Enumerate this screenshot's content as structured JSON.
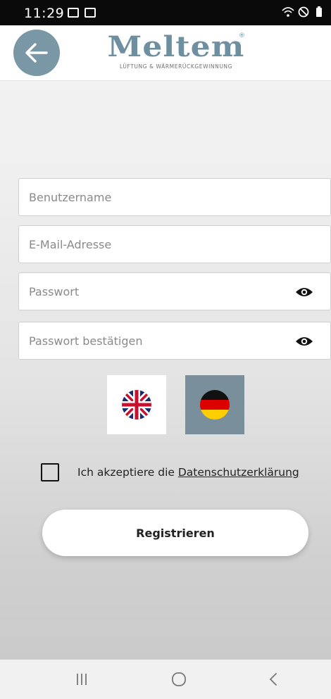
{
  "status_bar": {
    "time": "11:29",
    "icons": [
      "gallery-icon",
      "message-icon",
      "wifi-icon",
      "no-sim-icon",
      "battery-icon"
    ]
  },
  "header": {
    "back_icon": "arrow-left-icon",
    "logo_text": "Meltem",
    "logo_tagline": "LÜFTUNG & WÄRMERÜCKGEWINNUNG",
    "logo_mark": "®",
    "accent_color": "#7a97a6"
  },
  "form": {
    "username": {
      "placeholder": "Benutzername",
      "value": ""
    },
    "email": {
      "placeholder": "E-Mail-Adresse",
      "value": ""
    },
    "password": {
      "placeholder": "Passwort",
      "value": "",
      "icon": "eye-icon"
    },
    "password_confirm": {
      "placeholder": "Passwort bestätigen",
      "value": "",
      "icon": "eye-icon"
    }
  },
  "languages": {
    "options": [
      "en-flag",
      "de-flag"
    ],
    "selected": "de-flag",
    "selected_color": "#7a8f9c"
  },
  "consent": {
    "prefix": "Ich akzeptiere die",
    "link_label": "Datenschutzerklärung",
    "checked": false
  },
  "actions": {
    "register_label": "Registrieren"
  },
  "nav_bar": {
    "icons": [
      "recents-icon",
      "home-icon",
      "back-icon"
    ]
  }
}
